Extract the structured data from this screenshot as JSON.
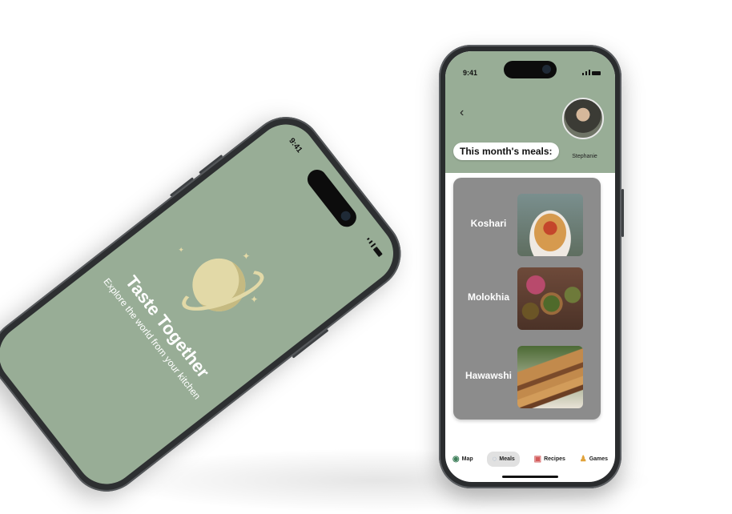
{
  "left_phone": {
    "time": "9:41",
    "app_title": "Taste Together",
    "tagline": "Explore the world from your kitchen",
    "logo_icon": "planet-dumpling-logo",
    "background": "#98ad96",
    "logo_color": "#e2d9a7"
  },
  "right_phone": {
    "time": "9:41",
    "back_icon": "chevron-left-icon",
    "user_name": "Stephanie",
    "section_title": "This month's meals:",
    "meals": [
      {
        "name": "Koshari"
      },
      {
        "name": "Molokhia"
      },
      {
        "name": "Hawawshi"
      }
    ],
    "nav": [
      {
        "label": "Map",
        "icon": "map-icon"
      },
      {
        "label": "Meals",
        "icon": "meals-icon",
        "active": true
      },
      {
        "label": "Recipes",
        "icon": "recipes-icon"
      },
      {
        "label": "Games",
        "icon": "games-icon"
      }
    ],
    "header_color": "#98ad96",
    "panel_color": "#8c8c8c"
  }
}
